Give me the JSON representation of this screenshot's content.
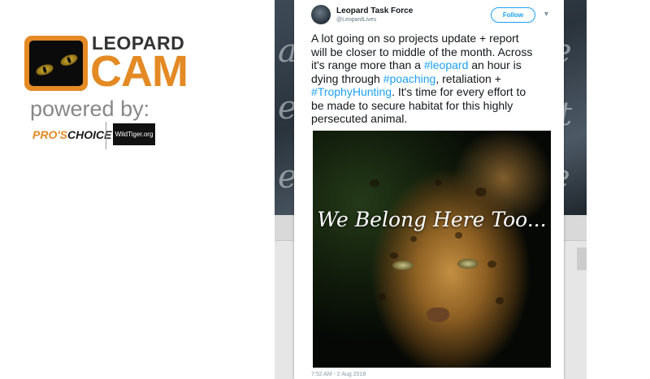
{
  "branding": {
    "logo_top": "LEOPARD",
    "logo_big": "CAM",
    "powered_by": "powered by:",
    "sponsor_1_a": "PRO'S",
    "sponsor_1_b": "CHOICE",
    "sponsor_2": "WildTiger.org"
  },
  "video_overlay_text": [
    "a",
    "e",
    "ec",
    "e",
    "t",
    "e"
  ],
  "tweet": {
    "author_name": "Leopard Task Force",
    "author_handle": "@LeopardLives",
    "follow_label": "Follow",
    "menu_icon": "chevron-down-icon",
    "text_lines": [
      [
        {
          "t": "A lot going on so projects update + report"
        }
      ],
      [
        {
          "t": "will be closer to middle of the month.  Across"
        }
      ],
      [
        {
          "t": "it's range more than a "
        },
        {
          "t": "#leopard",
          "tag": true
        },
        {
          "t": " an hour is"
        }
      ],
      [
        {
          "t": "dying through "
        },
        {
          "t": "#poaching",
          "tag": true
        },
        {
          "t": ", retaliation +"
        }
      ],
      [
        {
          "t": "#TrophyHunting",
          "tag": true
        },
        {
          "t": ".  It's time for every effort to"
        }
      ],
      [
        {
          "t": "be made to secure habitat for this highly"
        }
      ],
      [
        {
          "t": "persecuted animal."
        }
      ]
    ],
    "image_caption": "We Belong Here Too...",
    "timestamp": "7:52 AM - 2 Aug 2018"
  },
  "colors": {
    "brand_orange": "#e48a25",
    "link_blue": "#1da1f2"
  }
}
